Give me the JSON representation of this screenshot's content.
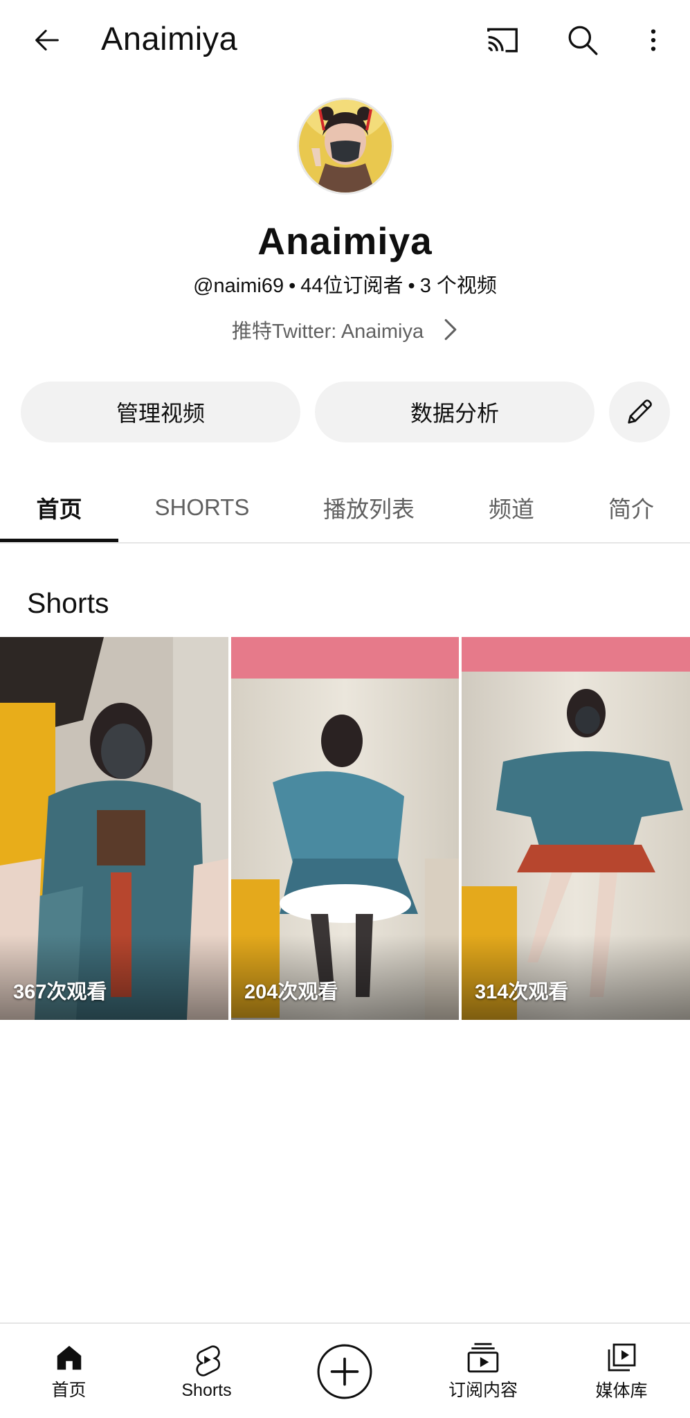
{
  "topbar": {
    "title": "Anaimiya",
    "icons": [
      "back-arrow-icon",
      "cast-icon",
      "search-icon",
      "more-vert-icon"
    ]
  },
  "channel": {
    "name": "Anaimiya",
    "handle": "@naimi69",
    "subscribers": "44位订阅者",
    "videos": "3 个视频",
    "separator": "•",
    "link_text": "推特Twitter: Anaimiya"
  },
  "actions": {
    "manage_label": "管理视频",
    "analytics_label": "数据分析",
    "edit_icon": "pencil-icon"
  },
  "tabs": [
    {
      "label": "首页",
      "active": true
    },
    {
      "label": "SHORTS",
      "active": false
    },
    {
      "label": "播放列表",
      "active": false
    },
    {
      "label": "频道",
      "active": false
    },
    {
      "label": "简介",
      "active": false
    }
  ],
  "shorts_section": {
    "title": "Shorts",
    "items": [
      {
        "views": "367次观看"
      },
      {
        "views": "204次观看"
      },
      {
        "views": "314次观看"
      }
    ]
  },
  "bottom_nav": [
    {
      "label": "首页",
      "icon": "home-icon"
    },
    {
      "label": "Shorts",
      "icon": "shorts-icon"
    },
    {
      "label": "",
      "icon": "create-plus-icon"
    },
    {
      "label": "订阅内容",
      "icon": "subscriptions-icon"
    },
    {
      "label": "媒体库",
      "icon": "library-icon"
    }
  ],
  "colors": {
    "text_primary": "#0f0f0f",
    "text_secondary": "#606060",
    "pill_bg": "#f2f2f2",
    "divider": "#e5e5e5"
  }
}
